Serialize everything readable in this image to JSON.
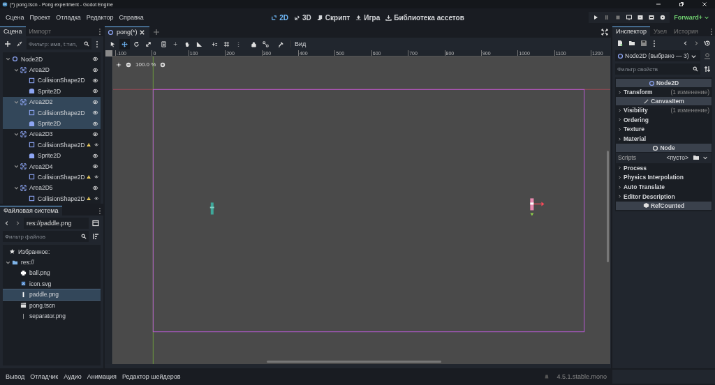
{
  "window": {
    "title": "(*) pong.tscn - Pong experiment - Godot Engine"
  },
  "menu": [
    "Сцена",
    "Проект",
    "Отладка",
    "Редактор",
    "Справка"
  ],
  "main_screens": [
    {
      "label": "2D",
      "kind": "flat",
      "selected": true
    },
    {
      "label": "3D",
      "kind": "spatial",
      "selected": false
    },
    {
      "label": "Скрипт",
      "kind": "script",
      "selected": false
    },
    {
      "label": "Игра",
      "kind": "game",
      "selected": false
    },
    {
      "label": "Библиотека ассетов",
      "kind": "assets",
      "selected": false
    }
  ],
  "renderer": "Forward+",
  "scene_dock": {
    "tabs": [
      {
        "label": "Сцена",
        "selected": true
      },
      {
        "label": "Импорт",
        "selected": false
      }
    ],
    "filter": {
      "placeholder": "Фильтр: имя, t:тип,"
    },
    "tree": [
      {
        "name": "Node2D",
        "kind": "node",
        "expanded": true,
        "selected": false,
        "warning": false,
        "children": [
          {
            "name": "Area2D",
            "kind": "area",
            "expanded": true,
            "selected": false,
            "warning": false,
            "children": [
              {
                "name": "CollisionShape2D",
                "kind": "collision",
                "selected": false,
                "warning": false
              },
              {
                "name": "Sprite2D",
                "kind": "sprite",
                "selected": false,
                "warning": false
              }
            ]
          },
          {
            "name": "Area2D2",
            "kind": "area",
            "expanded": true,
            "selected": true,
            "warning": false,
            "children": [
              {
                "name": "CollisionShape2D",
                "kind": "collision",
                "selected": true,
                "warning": false
              },
              {
                "name": "Sprite2D",
                "kind": "sprite",
                "selected": true,
                "warning": false
              }
            ]
          },
          {
            "name": "Area2D3",
            "kind": "area",
            "expanded": true,
            "selected": false,
            "warning": false,
            "children": [
              {
                "name": "CollisionShape2D",
                "kind": "collision",
                "selected": false,
                "warning": true
              },
              {
                "name": "Sprite2D",
                "kind": "sprite",
                "selected": false,
                "warning": false
              }
            ]
          },
          {
            "name": "Area2D4",
            "kind": "area",
            "expanded": true,
            "selected": false,
            "warning": false,
            "children": [
              {
                "name": "CollisionShape2D",
                "kind": "collision",
                "selected": false,
                "warning": true
              }
            ]
          },
          {
            "name": "Area2D5",
            "kind": "area",
            "expanded": true,
            "selected": false,
            "warning": false,
            "children": [
              {
                "name": "CollisionShape2D",
                "kind": "collision",
                "selected": false,
                "warning": true
              }
            ]
          }
        ]
      }
    ]
  },
  "filesystem": {
    "tabs": [
      {
        "label": "Файловая система",
        "selected": true
      }
    ],
    "path": "res://paddle.png",
    "filter": {
      "placeholder": "Фильтр файлов"
    },
    "favorites": "Избранное:",
    "tree": [
      {
        "name": "res://",
        "kind": "folder",
        "expanded": true,
        "selected": false,
        "children": [
          {
            "name": "ball.png",
            "kind": "ball",
            "selected": false
          },
          {
            "name": "icon.svg",
            "kind": "vector",
            "selected": false
          },
          {
            "name": "paddle.png",
            "kind": "paddle",
            "selected": true
          },
          {
            "name": "pong.tscn",
            "kind": "scene",
            "selected": false
          },
          {
            "name": "separator.png",
            "kind": "line",
            "selected": false
          }
        ]
      }
    ]
  },
  "editor_tabs": [
    {
      "label": "pong(*)",
      "selected": true
    }
  ],
  "toolbar": {
    "view_menu": "Вид"
  },
  "viewport": {
    "zoom": "100.0 %",
    "ruler_labels": [
      "-100",
      "0",
      "100",
      "200",
      "300",
      "400",
      "500",
      "600",
      "700",
      "800",
      "900",
      "1000",
      "1100",
      "1200"
    ]
  },
  "inspector": {
    "tabs": [
      {
        "label": "Инспектор",
        "selected": true
      },
      {
        "label": "Узел",
        "selected": false
      },
      {
        "label": "История",
        "selected": false
      }
    ],
    "object": "Node2D (выбрано — 3)",
    "filter": {
      "placeholder": "Фильтр свойств"
    },
    "sections": [
      {
        "kind": "header",
        "label": "Node2D"
      },
      {
        "kind": "group",
        "label": "Transform",
        "note": "(1 изменение)"
      },
      {
        "kind": "header",
        "label": "CanvasItem"
      },
      {
        "kind": "group",
        "label": "Visibility",
        "note": "(1 изменение)"
      },
      {
        "kind": "group",
        "label": "Ordering"
      },
      {
        "kind": "group",
        "label": "Texture"
      },
      {
        "kind": "group",
        "label": "Material"
      },
      {
        "kind": "header",
        "label": "Node"
      },
      {
        "kind": "property",
        "label": "Scripts",
        "value": "<пусто>"
      },
      {
        "kind": "group",
        "label": "Process"
      },
      {
        "kind": "group",
        "label": "Physics Interpolation"
      },
      {
        "kind": "group",
        "label": "Auto Translate"
      },
      {
        "kind": "group",
        "label": "Editor Description"
      },
      {
        "kind": "header",
        "label": "RefCounted"
      }
    ]
  },
  "bottom_panel": {
    "tabs": [
      "Вывод",
      "Отладчик",
      "Аудио",
      "Анимация",
      "Редактор шейдеров"
    ],
    "version": "4.5.1.stable.mono"
  }
}
